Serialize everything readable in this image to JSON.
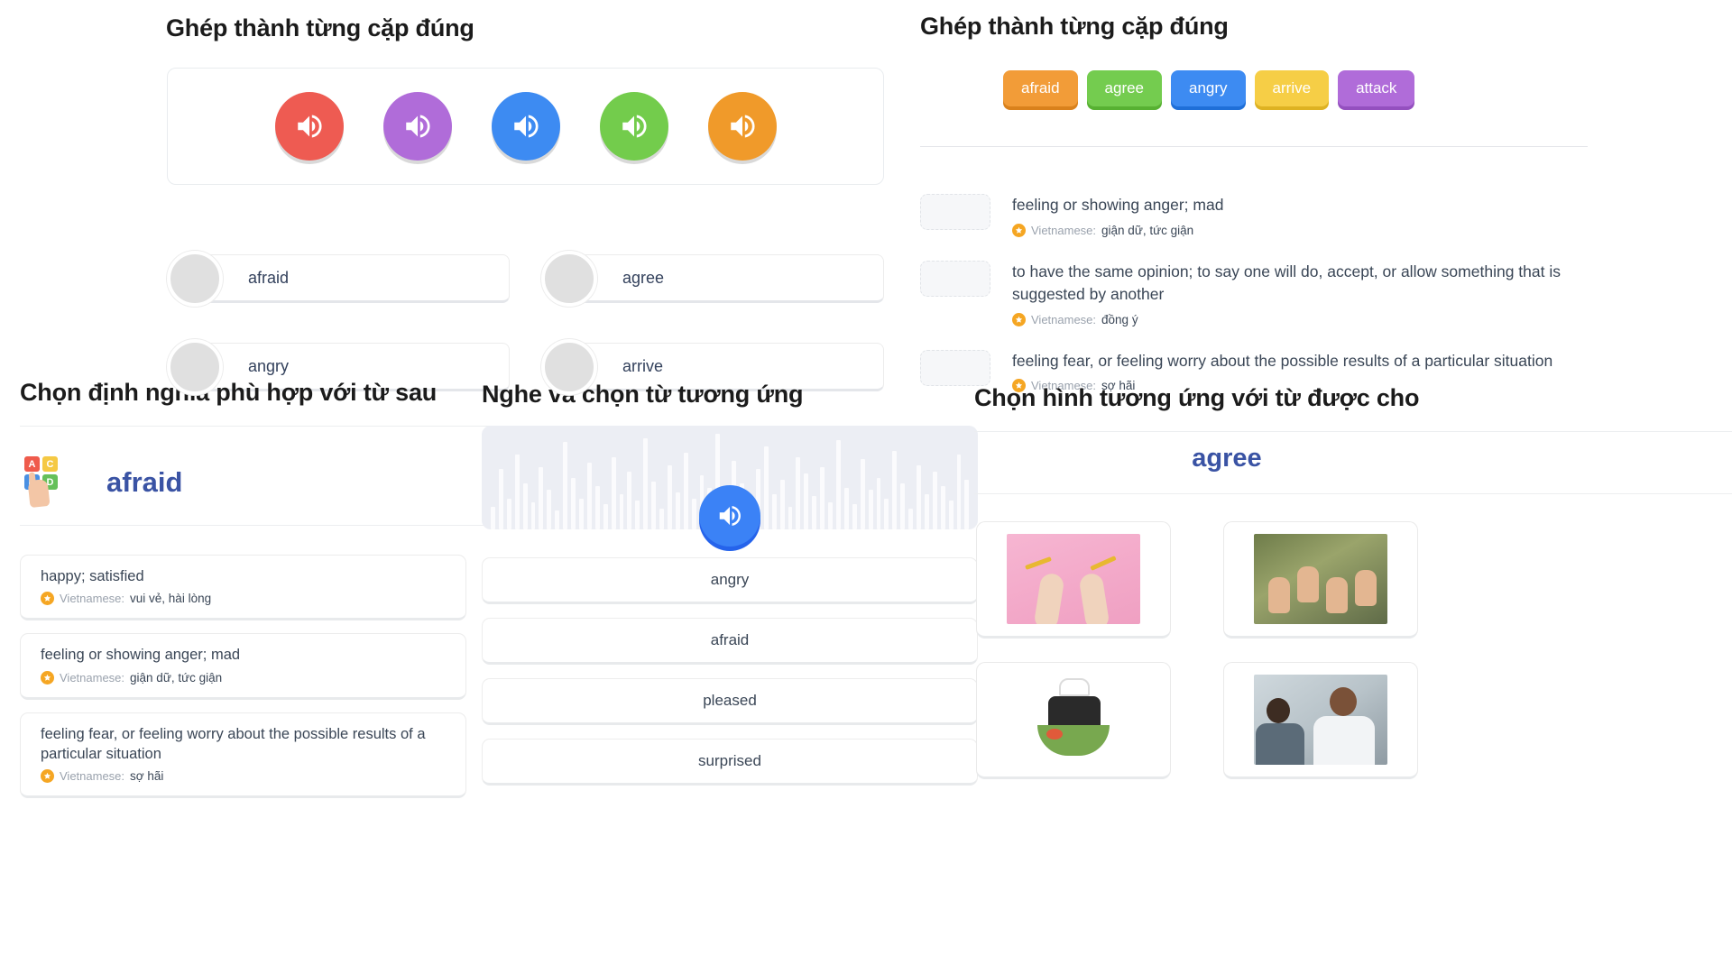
{
  "top_left": {
    "title": "Ghép thành từng cặp đúng",
    "audio_buttons": [
      {
        "name": "audio-1",
        "color": "#ee5b52"
      },
      {
        "name": "audio-2",
        "color": "#b06cd9"
      },
      {
        "name": "audio-3",
        "color": "#3d8bf2"
      },
      {
        "name": "audio-4",
        "color": "#73cc4c"
      },
      {
        "name": "audio-5",
        "color": "#f09a2a"
      }
    ],
    "pairs": [
      {
        "word": "afraid"
      },
      {
        "word": "agree"
      },
      {
        "word": "angry"
      },
      {
        "word": "arrive"
      }
    ]
  },
  "top_right": {
    "title": "Ghép thành từng cặp đúng",
    "chips": [
      {
        "label": "afraid",
        "color": "#f29c38",
        "shadow": "#d9811c"
      },
      {
        "label": "agree",
        "color": "#74cc4f",
        "shadow": "#57b132"
      },
      {
        "label": "angry",
        "color": "#3d8bf2",
        "shadow": "#1f6fd8"
      },
      {
        "label": "arrive",
        "color": "#f6ce46",
        "shadow": "#deb222"
      },
      {
        "label": "attack",
        "color": "#b06cd9",
        "shadow": "#9450bf"
      }
    ],
    "definitions": [
      {
        "text": "feeling or showing anger; mad",
        "vn_label": "Vietnamese:",
        "vn_value": "giận dữ, tức giận"
      },
      {
        "text": "to have the same opinion; to say one will do, accept, or allow something that is suggested by another",
        "vn_label": "Vietnamese:",
        "vn_value": "đồng ý"
      },
      {
        "text": "feeling fear, or feeling worry about the possible results of a particular situation",
        "vn_label": "Vietnamese:",
        "vn_value": "sợ hãi"
      }
    ]
  },
  "bottom_left": {
    "title": "Chọn định nghĩa phù hợp với từ sau",
    "word": "afraid",
    "icon_letters": [
      "A",
      "C",
      "B",
      "D"
    ],
    "options": [
      {
        "text": "happy; satisfied",
        "vn_label": "Vietnamese:",
        "vn_value": "vui vẻ, hài lòng"
      },
      {
        "text": "feeling or showing anger; mad",
        "vn_label": "Vietnamese:",
        "vn_value": "giận dữ, tức giận"
      },
      {
        "text": "feeling fear, or feeling worry about the possible results of a particular situation",
        "vn_label": "Vietnamese:",
        "vn_value": "sợ hãi"
      }
    ]
  },
  "bottom_mid": {
    "title": "Nghe và chọn từ tương ứng",
    "play_button_color": "#3b82f6",
    "waveform": [
      22,
      58,
      30,
      72,
      44,
      26,
      60,
      38,
      18,
      84,
      50,
      30,
      64,
      42,
      24,
      70,
      34,
      56,
      28,
      88,
      46,
      20,
      62,
      36,
      74,
      30,
      52,
      40,
      92,
      24,
      66,
      44,
      28,
      58,
      80,
      34,
      48,
      22,
      70,
      54,
      32,
      60,
      26,
      86,
      40,
      24,
      68,
      38,
      50,
      30,
      76,
      44,
      20,
      62,
      34,
      56,
      42,
      28,
      72,
      48
    ],
    "options": [
      {
        "label": "angry"
      },
      {
        "label": "afraid"
      },
      {
        "label": "pleased"
      },
      {
        "label": "surprised"
      }
    ]
  },
  "bottom_right": {
    "title": "Chọn hình tương ứng với từ được cho",
    "word": "agree",
    "images": [
      {
        "alt": "hands-breaking-pencil",
        "kind": "pencil"
      },
      {
        "alt": "thumbs-up-group",
        "kind": "thumbs"
      },
      {
        "alt": "chef-holding-salad",
        "kind": "chef"
      },
      {
        "alt": "doctor-consulting-patient",
        "kind": "doc"
      }
    ]
  }
}
